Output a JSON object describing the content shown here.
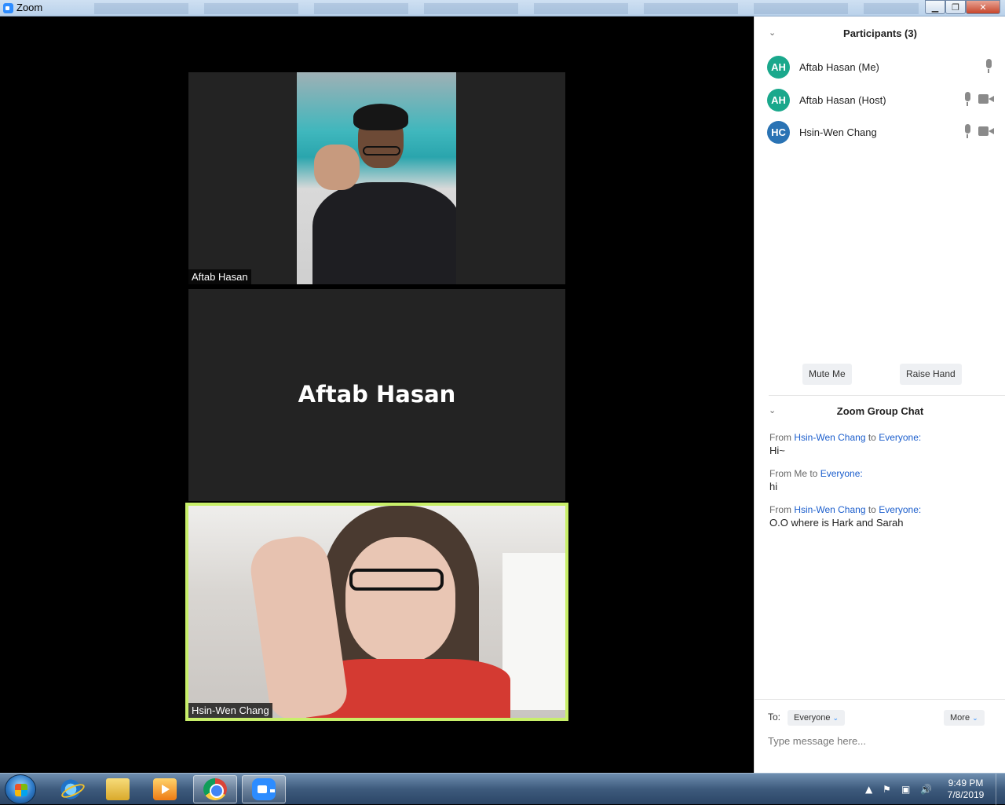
{
  "window": {
    "title": "Zoom"
  },
  "videos": {
    "tile1_name": "Aftab Hasan",
    "tile2_name": "Aftab Hasan",
    "tile3_name": "Hsin-Wen Chang"
  },
  "participants": {
    "header": "Participants (3)",
    "list": [
      {
        "initials": "AH",
        "name": "Aftab Hasan (Me)",
        "color": "#1aa88c"
      },
      {
        "initials": "AH",
        "name": "Aftab Hasan (Host)",
        "color": "#1aa88c"
      },
      {
        "initials": "HC",
        "name": "Hsin-Wen Chang",
        "color": "#2a73b4"
      }
    ],
    "mute_label": "Mute Me",
    "raise_label": "Raise Hand"
  },
  "chat": {
    "header": "Zoom Group Chat",
    "messages": [
      {
        "from_prefix": "From ",
        "sender": "Hsin-Wen Chang",
        "to": " to ",
        "recipient": "Everyone:",
        "text": "Hi~"
      },
      {
        "from_prefix": "From Me to ",
        "sender": "",
        "to": "",
        "recipient": "Everyone:",
        "text": "hi"
      },
      {
        "from_prefix": "From ",
        "sender": "Hsin-Wen Chang",
        "to": " to ",
        "recipient": "Everyone:",
        "text": "O.O where is Hark and Sarah"
      }
    ],
    "to_label": "To:",
    "to_value": "Everyone",
    "more_label": "More",
    "input_placeholder": "Type message here..."
  },
  "taskbar": {
    "time": "9:49 PM",
    "date": "7/8/2019",
    "pinned": [
      "windows-start-icon",
      "internet-explorer-icon",
      "file-explorer-icon",
      "media-player-icon",
      "chrome-icon",
      "zoom-icon"
    ]
  }
}
